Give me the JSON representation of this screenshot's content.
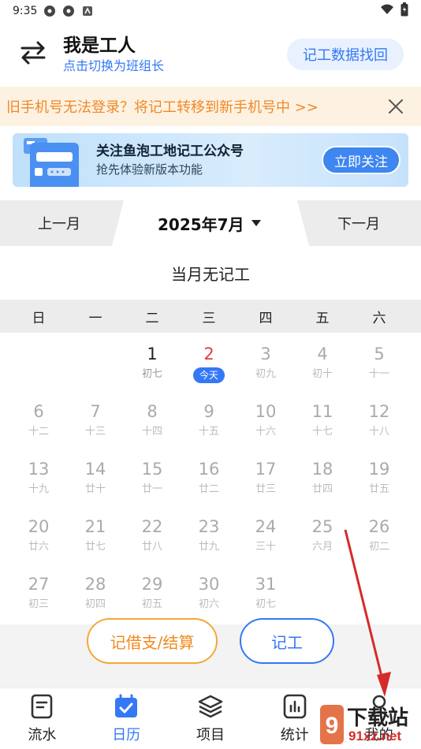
{
  "status": {
    "time": "9:35"
  },
  "header": {
    "role_title": "我是工人",
    "role_sub": "点击切换为班组长",
    "recover_label": "记工数据找回"
  },
  "notice": {
    "text": "旧手机号无法登录？将记工转移到新手机号中  >>"
  },
  "banner": {
    "title": "关注鱼泡工地记工公众号",
    "subtitle": "抢先体验新版本功能",
    "button": "立即关注"
  },
  "month_nav": {
    "prev": "上一月",
    "current": "2025年7月",
    "next": "下一月"
  },
  "summary": "当月无记工",
  "weekdays": [
    "日",
    "一",
    "二",
    "三",
    "四",
    "五",
    "六"
  ],
  "days": [
    {
      "d": "",
      "l": ""
    },
    {
      "d": "",
      "l": ""
    },
    {
      "d": "1",
      "l": "初七",
      "state": "real"
    },
    {
      "d": "2",
      "l": "今天",
      "state": "today"
    },
    {
      "d": "3",
      "l": "初九"
    },
    {
      "d": "4",
      "l": "初十"
    },
    {
      "d": "5",
      "l": "十一"
    },
    {
      "d": "6",
      "l": "十二"
    },
    {
      "d": "7",
      "l": "十三"
    },
    {
      "d": "8",
      "l": "十四"
    },
    {
      "d": "9",
      "l": "十五"
    },
    {
      "d": "10",
      "l": "十六"
    },
    {
      "d": "11",
      "l": "十七"
    },
    {
      "d": "12",
      "l": "十八"
    },
    {
      "d": "13",
      "l": "十九"
    },
    {
      "d": "14",
      "l": "廿十"
    },
    {
      "d": "15",
      "l": "廿一"
    },
    {
      "d": "16",
      "l": "廿二"
    },
    {
      "d": "17",
      "l": "廿三"
    },
    {
      "d": "18",
      "l": "廿四"
    },
    {
      "d": "19",
      "l": "廿五"
    },
    {
      "d": "20",
      "l": "廿六"
    },
    {
      "d": "21",
      "l": "廿七"
    },
    {
      "d": "22",
      "l": "廿八"
    },
    {
      "d": "23",
      "l": "廿九"
    },
    {
      "d": "24",
      "l": "三十"
    },
    {
      "d": "25",
      "l": "六月"
    },
    {
      "d": "26",
      "l": "初二"
    },
    {
      "d": "27",
      "l": "初三"
    },
    {
      "d": "28",
      "l": "初四"
    },
    {
      "d": "29",
      "l": "初五"
    },
    {
      "d": "30",
      "l": "初六"
    },
    {
      "d": "31",
      "l": "初七"
    }
  ],
  "actions": {
    "debt": "记借支/结算",
    "record": "记工"
  },
  "tabs": [
    {
      "label": "流水",
      "icon": "document-icon"
    },
    {
      "label": "日历",
      "icon": "calendar-icon",
      "active": true
    },
    {
      "label": "项目",
      "icon": "layers-icon"
    },
    {
      "label": "统计",
      "icon": "chart-icon"
    },
    {
      "label": "我的",
      "icon": "person-icon"
    }
  ],
  "watermark": {
    "cn": "下载站",
    "url": "91xz.net"
  },
  "colors": {
    "accent": "#3478f6",
    "warn": "#f08a1e",
    "today": "#e33d3d"
  }
}
